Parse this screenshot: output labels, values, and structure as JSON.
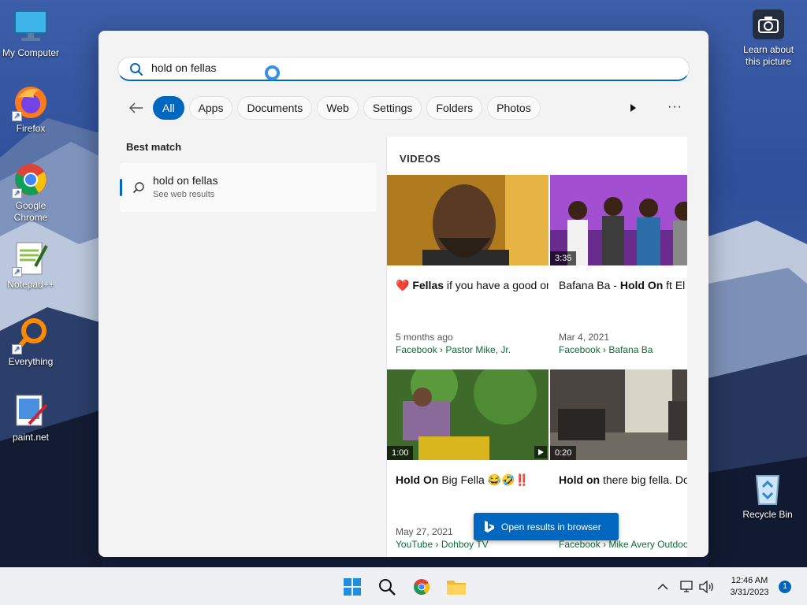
{
  "desktop": {
    "icons": [
      {
        "label": "My Computer"
      },
      {
        "label": "Firefox"
      },
      {
        "label": "Google Chrome"
      },
      {
        "label": "Notepad++"
      },
      {
        "label": "Everything"
      },
      {
        "label": "paint.net"
      }
    ],
    "right_icons": [
      {
        "label": "Learn about this picture"
      },
      {
        "label": "Recycle Bin"
      }
    ]
  },
  "search": {
    "query": "hold on fellas",
    "filters": [
      "All",
      "Apps",
      "Documents",
      "Web",
      "Settings",
      "Folders",
      "Photos"
    ],
    "active_filter": "All",
    "more_label": "···"
  },
  "best_match": {
    "heading": "Best match",
    "title": "hold on fellas",
    "subtitle": "See web results"
  },
  "videos": {
    "heading": "VIDEOS",
    "cards": [
      {
        "duration": "",
        "title_html": "❤️ <b>Fellas</b> if you have a good one <b>hold</b>... - Pastor Mike, Jr.",
        "date": "5 months ago",
        "source": "Facebook › Pastor Mike, Jr."
      },
      {
        "duration": "3:35",
        "title_html": "Bafana Ba - <b>Hold On</b> ft El Dee (Prod by Fella)",
        "date": "Mar 4, 2021",
        "source": "Facebook › Bafana Ba"
      },
      {
        "duration": "1:00",
        "title_html": "<b>Hold On</b> Big Fella 😂🤣‼️",
        "date": "May 27, 2021",
        "source": "YouTube › Dohboy TV"
      },
      {
        "duration": "0:20",
        "title_html": "<b>Hold on</b> there big fella. Do you... - Mike Avery Outdoors",
        "date": "",
        "source": "Facebook › Mike Avery Outdoors"
      }
    ]
  },
  "open_button": "Open results in browser",
  "taskbar": {
    "time": "12:46 AM",
    "date": "3/31/2023",
    "notifications": "1"
  },
  "colors": {
    "accent": "#0067c0",
    "source_green": "#0e6b37"
  }
}
